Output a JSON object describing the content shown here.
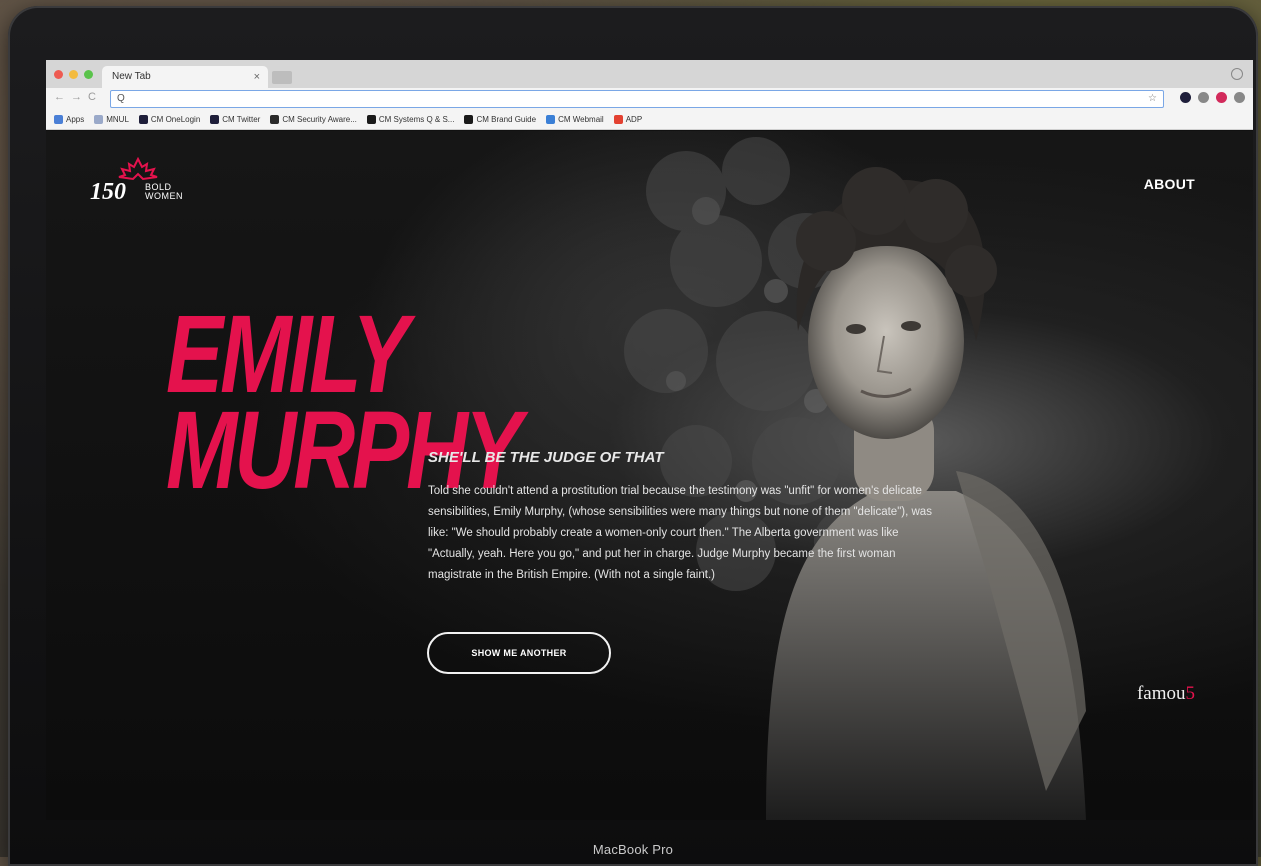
{
  "device": {
    "label": "MacBook Pro"
  },
  "browser": {
    "tab_title": "New Tab",
    "tab_close": "×",
    "address_value": "",
    "nav_back": "←",
    "nav_forward": "→",
    "nav_reload": "C",
    "search_glyph": "Q",
    "bookmark_star": "☆",
    "bookmarks": [
      {
        "label": "Apps",
        "color": "#4a7fd6"
      },
      {
        "label": "MNUL",
        "color": "#9aa9c9"
      },
      {
        "label": "CM OneLogin",
        "color": "#1e1e3a"
      },
      {
        "label": "CM Twitter",
        "color": "#1e1e3a"
      },
      {
        "label": "CM Security Aware...",
        "color": "#2a2a2a"
      },
      {
        "label": "CM Systems Q & S...",
        "color": "#1a1a1a"
      },
      {
        "label": "CM Brand Guide",
        "color": "#1a1a1a"
      },
      {
        "label": "CM Webmail",
        "color": "#3a7fd6"
      },
      {
        "label": "ADP",
        "color": "#e34131"
      }
    ],
    "extensions": [
      "#1e1e3a",
      "#888888",
      "#d22a5b",
      "#888888"
    ]
  },
  "site": {
    "logo_number": "150",
    "logo_line1": "BOLD",
    "logo_line2": "WOMEN",
    "nav_about": "ABOUT",
    "name_line1": "EMILY",
    "name_line2": "MURPHY",
    "tagline": "SHE'LL BE THE JUDGE OF THAT",
    "story": "Told she couldn't attend a prostitution trial because the testimony was \"unfit\" for women's delicate sensibilities, Emily Murphy, (whose sensibilities were many things but none of them \"delicate\"), was like: \"We should probably create a women-only court then.\" The Alberta government was like \"Actually, yeah. Here you go,\" and put her in charge. Judge Murphy became the first woman magistrate in the British Empire. (With not a single faint.)",
    "cta_button": "SHOW ME ANOTHER",
    "partner_text": "famou",
    "partner_number": "5",
    "accent_color": "#e4124d"
  }
}
